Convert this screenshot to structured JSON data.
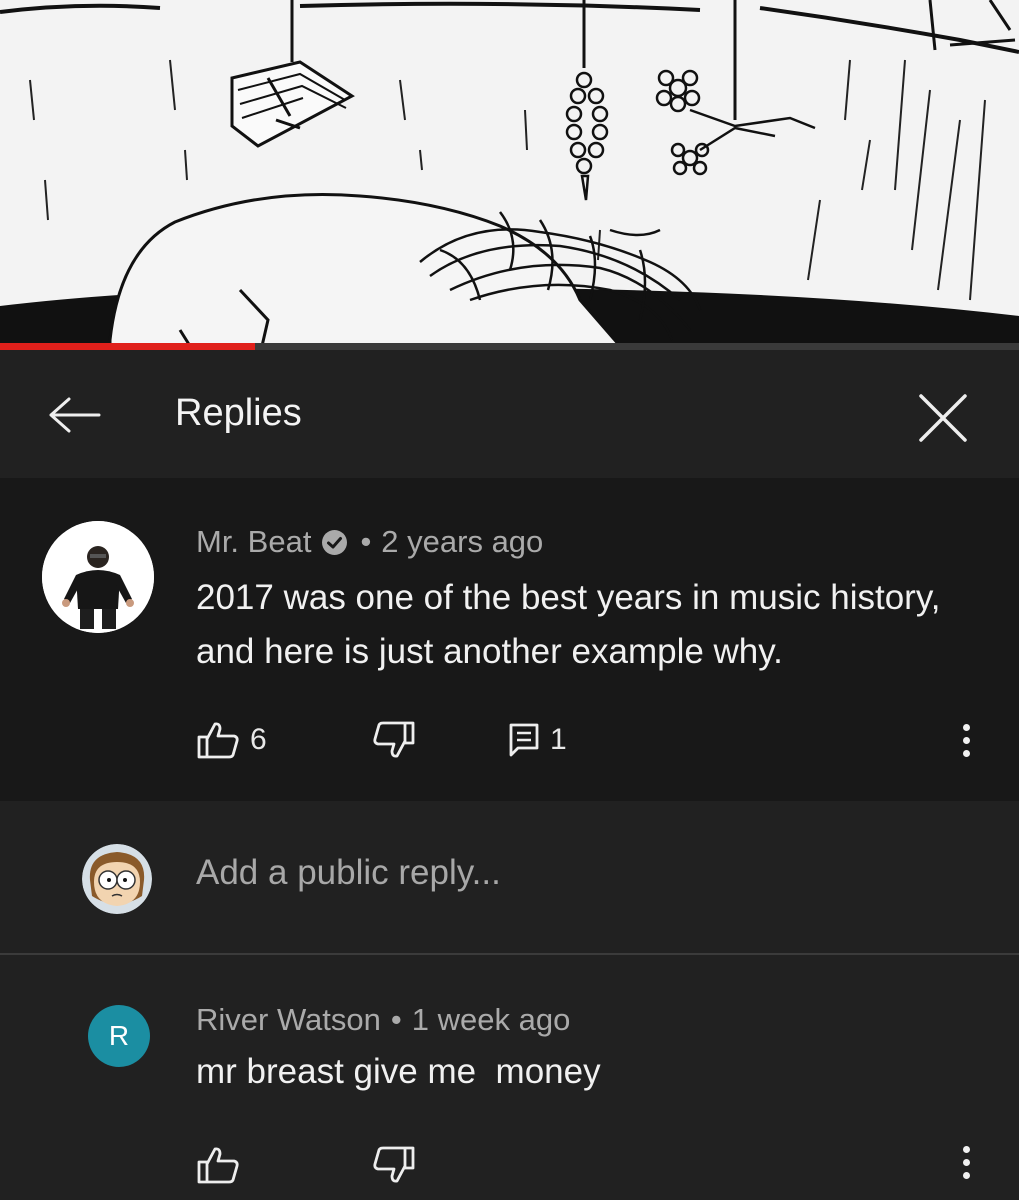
{
  "video": {
    "progress_fraction": 0.25,
    "progress_color": "#e0201b"
  },
  "header": {
    "title": "Replies",
    "back_icon": "arrow-left-icon",
    "close_icon": "close-icon"
  },
  "main_comment": {
    "author": "Mr. Beat",
    "verified": true,
    "separator": "•",
    "time": "2 years ago",
    "text": "2017 was one of the best years in music history, and here is just another example why.",
    "likes": "6",
    "replies": "1"
  },
  "reply_box": {
    "placeholder": "Add a public reply..."
  },
  "reply": {
    "avatar_letter": "R",
    "avatar_color": "#1b8ea2",
    "author": "River Watson",
    "separator": "•",
    "time": "1 week ago",
    "text": "mr breast give me  money"
  }
}
